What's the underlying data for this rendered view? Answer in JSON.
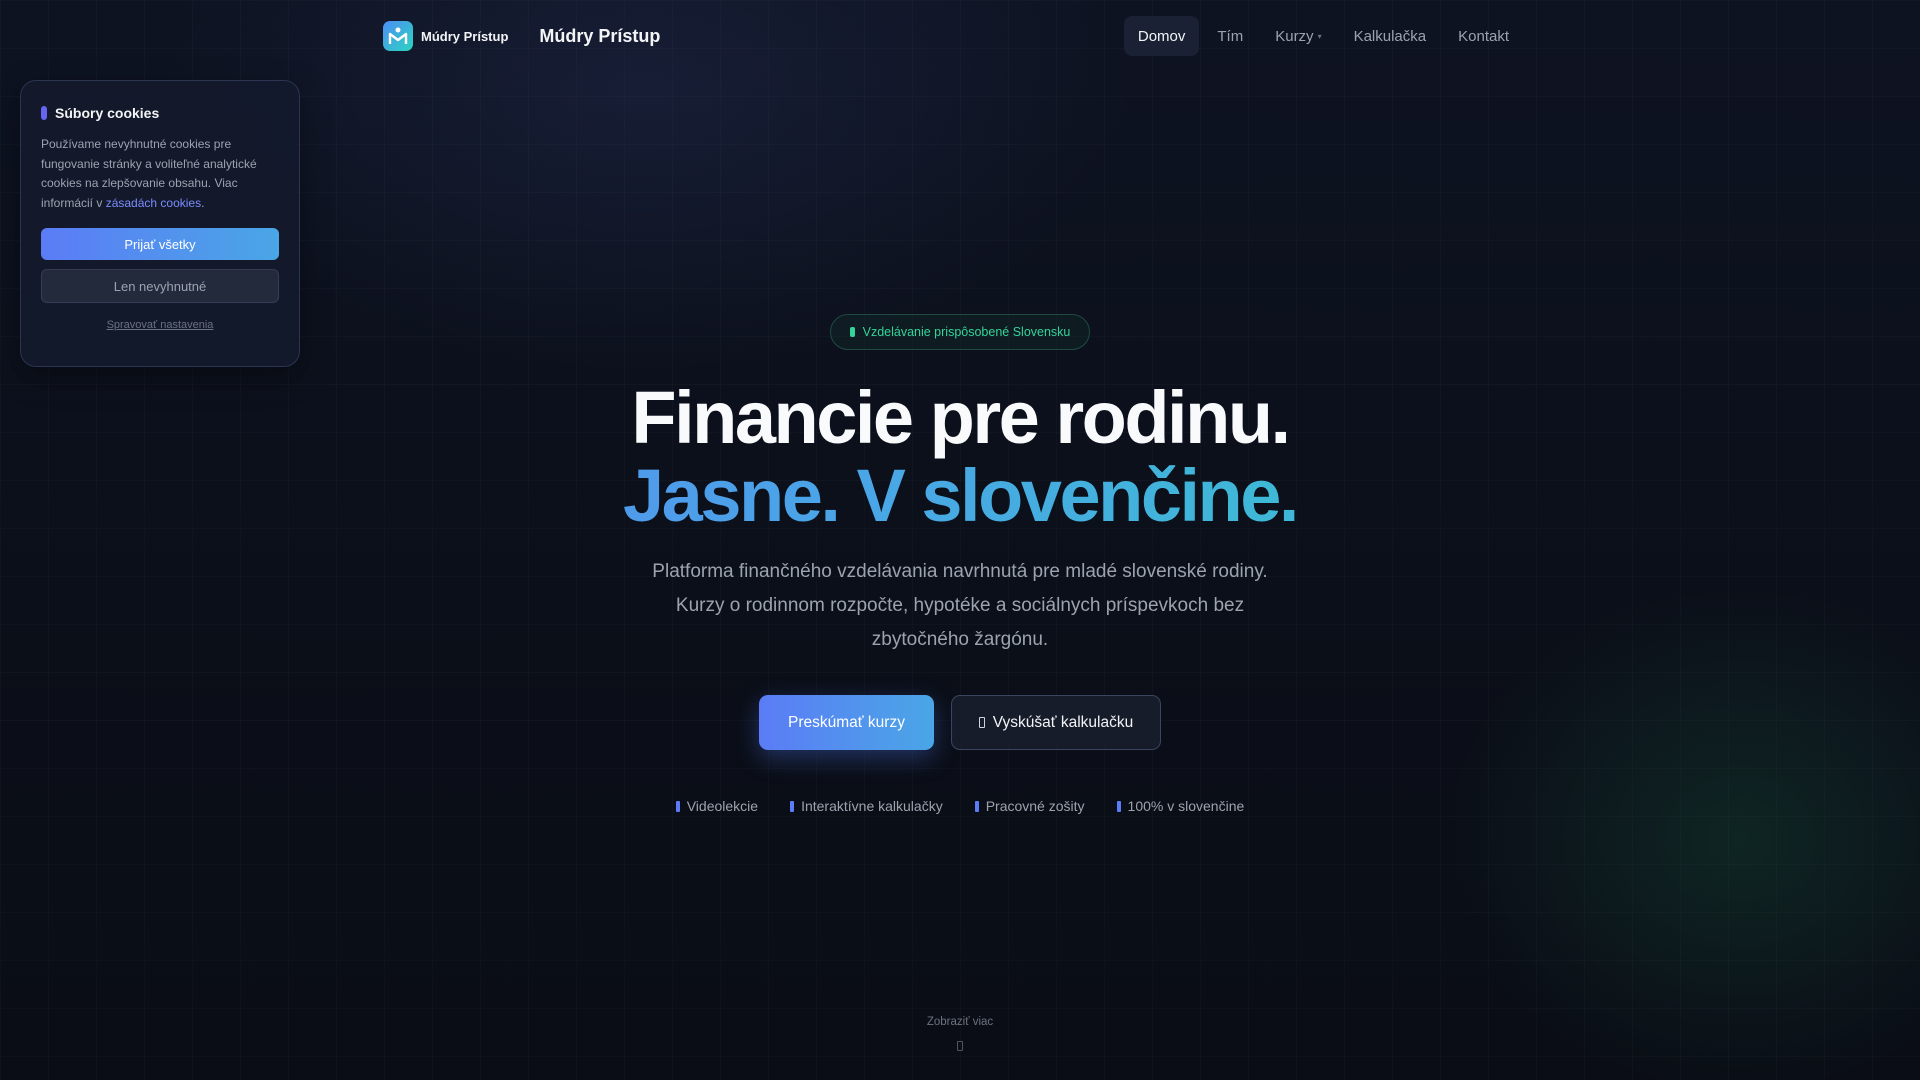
{
  "header": {
    "brand_small": "Múdry Prístup",
    "brand_title": "Múdry Prístup",
    "nav": [
      {
        "label": "Domov",
        "active": true
      },
      {
        "label": "Tím"
      },
      {
        "label": "Kurzy"
      },
      {
        "label": "Kalkulačka"
      },
      {
        "label": "Kontakt"
      }
    ]
  },
  "cookie": {
    "title": "Súbory cookies",
    "text_before_link": "Používame nevyhnutné cookies pre fungovanie stránky a voliteľné analytické cookies na zlepšovanie obsahu. Viac informácií v ",
    "link_text": "zásadách cookies",
    "text_after_link": ".",
    "accept_label": "Prijať všetky",
    "necessary_label": "Len nevyhnutné",
    "manage_label": "Spravovať nastavenia"
  },
  "hero": {
    "badge": "Vzdelávanie prispôsobené Slovensku",
    "headline_line1": "Financie pre rodinu.",
    "headline_line2": "Jasne. V slovenčine.",
    "description": "Platforma finančného vzdelávania navrhnutá pre mladé slovenské rodiny. Kurzy o rodinnom rozpočte, hypotéke a sociálnych príspevkoch bez zbytočného žargónu.",
    "primary_cta": "Preskúmať kurzy",
    "secondary_cta": "Vyskúšať kalkulačku",
    "features": [
      "Videolekcie",
      "Interaktívne kalkulačky",
      "Pracovné zošity",
      "100% v slovenčine"
    ],
    "scroll_label": "Zobraziť viac"
  },
  "colors": {
    "accent_blue": "#5b7cf6",
    "accent_teal": "#2dd4bf",
    "badge_green": "#34d399",
    "background": "#0b0f19"
  }
}
